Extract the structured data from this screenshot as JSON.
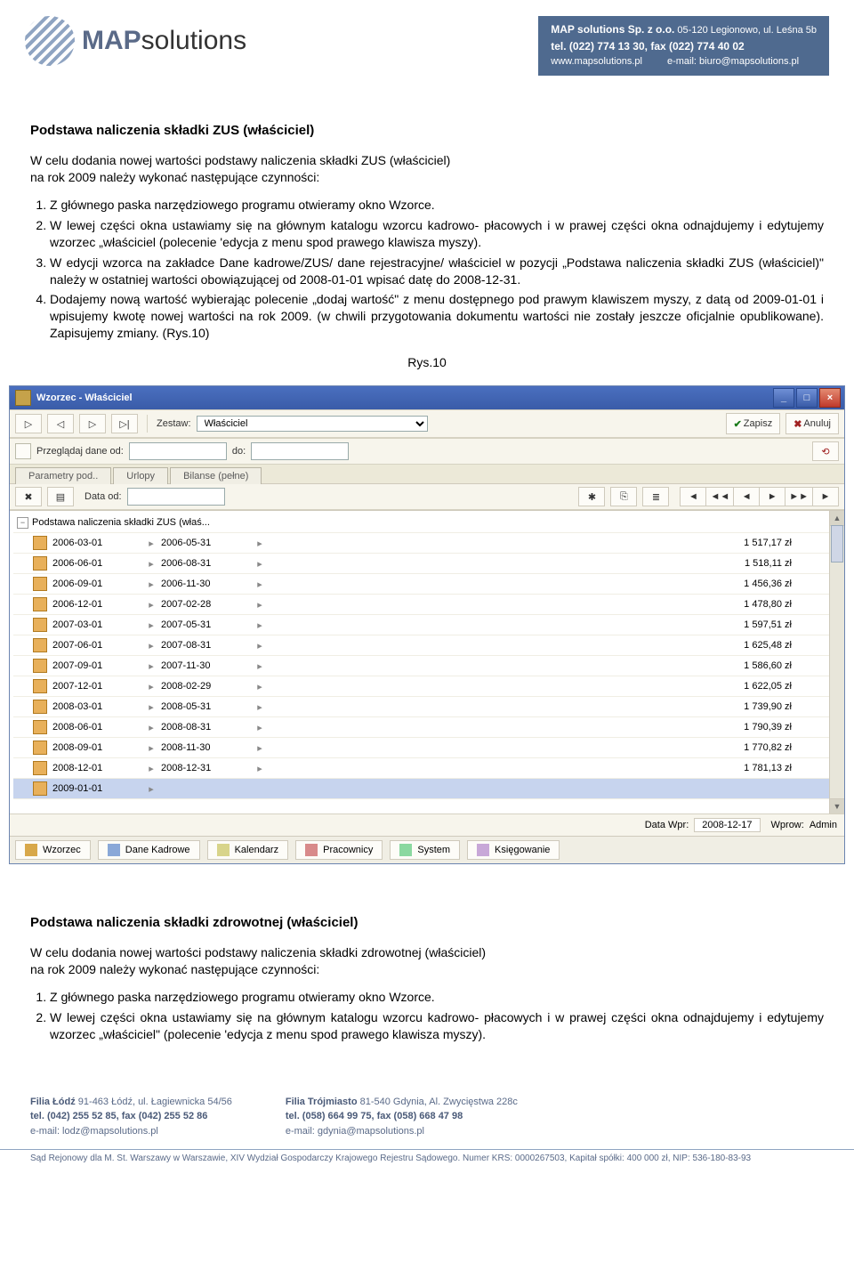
{
  "header": {
    "logo_text_a": "MAP",
    "logo_text_b": "solutions",
    "contact_company": "MAP solutions Sp. z o.o.",
    "contact_addr": " 05-120 Legionowo, ul. Leśna 5b",
    "contact_tel": "tel. (022) 774 13 30, fax (022) 774 40 02",
    "contact_www": "www.mapsolutions.pl",
    "contact_email": "e-mail: biuro@mapsolutions.pl"
  },
  "doc": {
    "h1": "Podstawa naliczenia składki ZUS (właściciel)",
    "intro1a": "W celu dodania nowej wartości podstawy naliczenia składki ZUS (właściciel)",
    "intro1b": "na rok 2009 należy wykonać następujące czynności:",
    "ol": [
      "Z głównego paska narzędziowego programu otwieramy okno Wzorce.",
      "W lewej części okna ustawiamy się na głównym katalogu wzorcu kadrowo- płacowych i w prawej części okna odnajdujemy i edytujemy wzorzec „właściciel (polecenie 'edycja z menu spod prawego klawisza myszy).",
      "W edycji wzorca na zakładce Dane kadrowe/ZUS/ dane rejestracyjne/ właściciel w pozycji „Podstawa naliczenia składki ZUS (właściciel)\" należy w ostatniej wartości obowiązującej od 2008-01-01 wpisać datę do 2008-12-31.",
      "Dodajemy nową wartość wybierając polecenie „dodaj wartość\" z menu dostępnego pod prawym klawiszem myszy, z datą od 2009-01-01 i wpisujemy kwotę nowej wartości na rok 2009. (w chwili przygotowania dokumentu wartości nie zostały jeszcze oficjalnie opublikowane). Zapisujemy zmiany. (Rys.10)"
    ],
    "fig_caption": "Rys.10",
    "h2": "Podstawa naliczenia składki zdrowotnej (właściciel)",
    "intro2a": "W celu dodania nowej wartości podstawy naliczenia składki zdrowotnej (właściciel)",
    "intro2b": "na rok 2009 należy wykonać następujące czynności:",
    "ol2": [
      "Z głównego paska narzędziowego programu otwieramy okno Wzorce.",
      "W lewej części okna ustawiamy się na głównym katalogu wzorcu kadrowo- płacowych i w prawej części okna odnajdujemy i edytujemy wzorzec „właściciel\" (polecenie 'edycja z menu spod prawego klawisza myszy)."
    ]
  },
  "app": {
    "title": "Wzorzec - Właściciel",
    "zestaw_label": "Zestaw:",
    "zestaw_value": "Właściciel",
    "zapisz": "Zapisz",
    "anuluj": "Anuluj",
    "przegladaj_label": "Przeglądaj dane od:",
    "do_label": "do:",
    "tabs": [
      "Parametry pod..",
      "Urlopy",
      "Bilanse (pełne)"
    ],
    "data_od_label": "Data od:",
    "nav": [
      "◄",
      "◄◄",
      "◄",
      "►",
      "►►",
      "►"
    ],
    "tree_root": "Podstawa naliczenia składki ZUS (właś...",
    "rows": [
      {
        "from": "2006-03-01",
        "to": "2006-05-31",
        "amount": "1 517,17 zł"
      },
      {
        "from": "2006-06-01",
        "to": "2006-08-31",
        "amount": "1 518,11 zł"
      },
      {
        "from": "2006-09-01",
        "to": "2006-11-30",
        "amount": "1 456,36 zł"
      },
      {
        "from": "2006-12-01",
        "to": "2007-02-28",
        "amount": "1 478,80 zł"
      },
      {
        "from": "2007-03-01",
        "to": "2007-05-31",
        "amount": "1 597,51 zł"
      },
      {
        "from": "2007-06-01",
        "to": "2007-08-31",
        "amount": "1 625,48 zł"
      },
      {
        "from": "2007-09-01",
        "to": "2007-11-30",
        "amount": "1 586,60 zł"
      },
      {
        "from": "2007-12-01",
        "to": "2008-02-29",
        "amount": "1 622,05 zł"
      },
      {
        "from": "2008-03-01",
        "to": "2008-05-31",
        "amount": "1 739,90 zł"
      },
      {
        "from": "2008-06-01",
        "to": "2008-08-31",
        "amount": "1 790,39 zł"
      },
      {
        "from": "2008-09-01",
        "to": "2008-11-30",
        "amount": "1 770,82 zł"
      },
      {
        "from": "2008-12-01",
        "to": "2008-12-31",
        "amount": "1 781,13 zł"
      },
      {
        "from": "2009-01-01",
        "to": "",
        "amount": ""
      }
    ],
    "selected_index": 12,
    "status_datawpr_label": "Data Wpr:",
    "status_datawpr_value": "2008-12-17",
    "status_wprow_label": "Wprow:",
    "status_wprow_value": "Admin",
    "footer_tabs": [
      "Wzorzec",
      "Dane Kadrowe",
      "Kalendarz",
      "Pracownicy",
      "System",
      "Księgowanie"
    ]
  },
  "footer": {
    "lodz_title": "Filia Łódź",
    "lodz_addr": " 91-463 Łódź, ul. Łagiewnicka 54/56",
    "lodz_tel": "tel. (042) 255 52 85, fax (042) 255 52 86",
    "lodz_email": "e-mail: lodz@mapsolutions.pl",
    "gdynia_title": "Filia Trójmiasto",
    "gdynia_addr": " 81-540 Gdynia, Al. Zwycięstwa 228c",
    "gdynia_tel": "tel. (058) 664 99 75, fax (058) 668 47 98",
    "gdynia_email": "e-mail: gdynia@mapsolutions.pl",
    "legal": "Sąd Rejonowy dla M. St. Warszawy w Warszawie, XIV Wydział Gospodarczy Krajowego Rejestru Sądowego. Numer KRS: 0000267503, Kapitał spółki: 400 000 zł, NIP: 536-180-83-93"
  }
}
